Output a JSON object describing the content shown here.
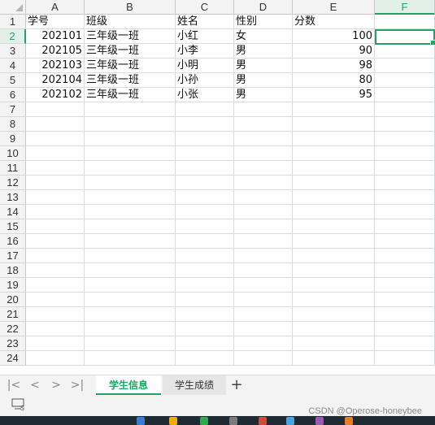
{
  "columns": [
    "A",
    "B",
    "C",
    "D",
    "E",
    "F"
  ],
  "active_column": "F",
  "active_row": 2,
  "row_numbers": [
    "1",
    "2",
    "3",
    "4",
    "5",
    "6",
    "7",
    "8",
    "9",
    "10",
    "11",
    "12",
    "13",
    "14",
    "15",
    "16",
    "17",
    "18",
    "19",
    "20",
    "21",
    "22",
    "23",
    "24"
  ],
  "rows": [
    [
      "学号",
      "班级",
      "姓名",
      "性别",
      "分数",
      ""
    ],
    [
      "202101",
      "三年级一班",
      "小红",
      "女",
      "100",
      ""
    ],
    [
      "202105",
      "三年级一班",
      "小李",
      "男",
      "90",
      ""
    ],
    [
      "202103",
      "三年级一班",
      "小明",
      "男",
      "98",
      ""
    ],
    [
      "202104",
      "三年级一班",
      "小孙",
      "男",
      "80",
      ""
    ],
    [
      "202102",
      "三年级一班",
      "小张",
      "男",
      "95",
      ""
    ]
  ],
  "tabs": [
    {
      "label": "学生信息",
      "active": true
    },
    {
      "label": "学生成绩",
      "active": false
    }
  ],
  "nav": {
    "first": "|<",
    "prev": "<",
    "next": ">",
    "last": ">|"
  },
  "add_tab_label": "+",
  "watermark": "CSDN @Operose-honeybee",
  "colors": {
    "accent": "#21a366",
    "grid": "#dadce0",
    "header_bg": "#f3f3f3"
  }
}
